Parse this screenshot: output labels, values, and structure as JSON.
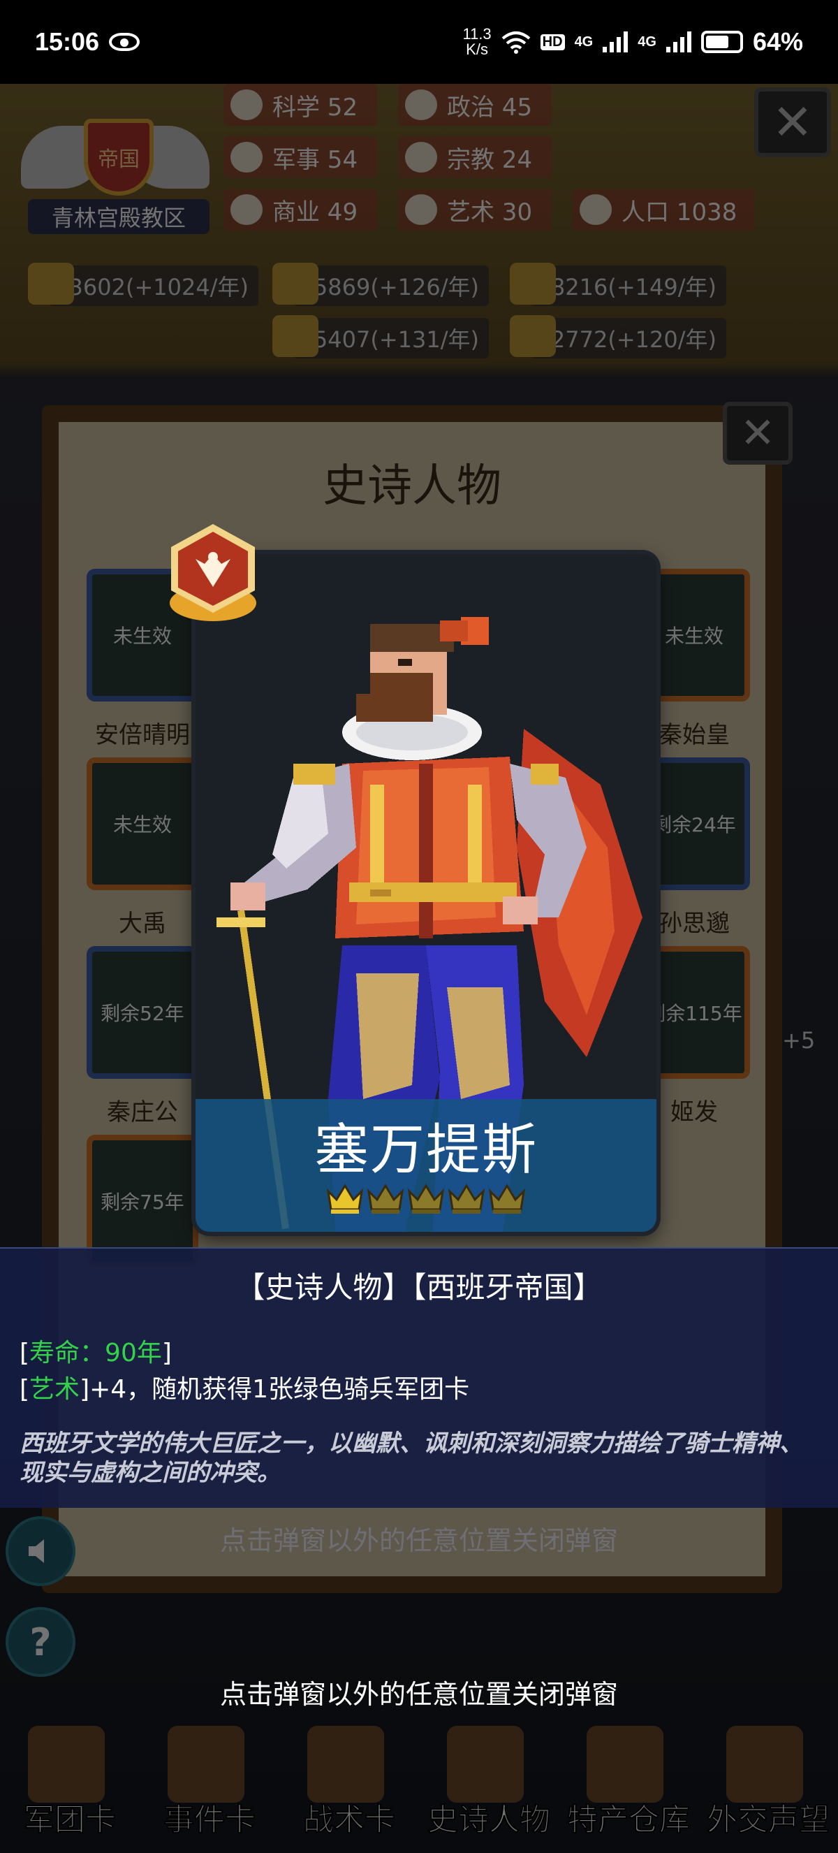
{
  "status_bar": {
    "time": "15:06",
    "net_speed_value": "11.3",
    "net_speed_unit": "K/s",
    "hd_label": "HD",
    "signal_label_1": "4G",
    "signal_label_2": "4G",
    "battery_percent": "64%"
  },
  "background": {
    "empire_label": "帝国",
    "location": "青林宫殿教区",
    "stats": {
      "science": "科学 52",
      "politics": "政治 45",
      "military": "军事 54",
      "religion": "宗教 24",
      "commerce": "商业 49",
      "art": "艺术 30",
      "population": "人口 1038"
    },
    "resources": {
      "gold": "13602(+1024/年)",
      "wood": "5869(+126/年)",
      "iron": "8216(+149/年)",
      "stone": "15407(+131/年)",
      "meat": "2772(+120/年)"
    },
    "panel_title": "史诗人物",
    "cards": [
      {
        "status": "未生效",
        "name": "安倍晴明"
      },
      {
        "status": "未生效",
        "name": "秦始皇"
      },
      {
        "status": "未生效",
        "name": "大禹"
      },
      {
        "status": "剩余24年",
        "name": "孙思邈"
      },
      {
        "status": "剩余52年",
        "name": "秦庄公"
      },
      {
        "status": "剩余115年",
        "name": "姬发"
      },
      {
        "status": "剩余75年",
        "name": ""
      }
    ],
    "side_plus": "+5",
    "nav_tabs": [
      "军团卡",
      "事件卡",
      "战术卡",
      "史诗人物",
      "特产仓库",
      "外交声望"
    ]
  },
  "modal": {
    "character_name": "塞万提斯",
    "stars_filled": 1,
    "stars_total": 5,
    "tags": "【史诗人物】【西班牙帝国】",
    "lifespan_open": "[",
    "lifespan": "寿命：90年",
    "lifespan_close": "]",
    "effect_open": "[",
    "effect_attr": "艺术",
    "effect_text": "]+4，随机获得1张绿色骑兵军团卡",
    "description": "西班牙文学的伟大巨匠之一，以幽默、讽刺和深刻洞察力描绘了骑士精神、现实与虚构之间的冲突。"
  },
  "hint_text": "点击弹窗以外的任意位置关闭弹窗",
  "colors": {
    "accent_green": "#34d24a",
    "banner_blue": "#165482",
    "crown_gold": "#e8c52a"
  }
}
